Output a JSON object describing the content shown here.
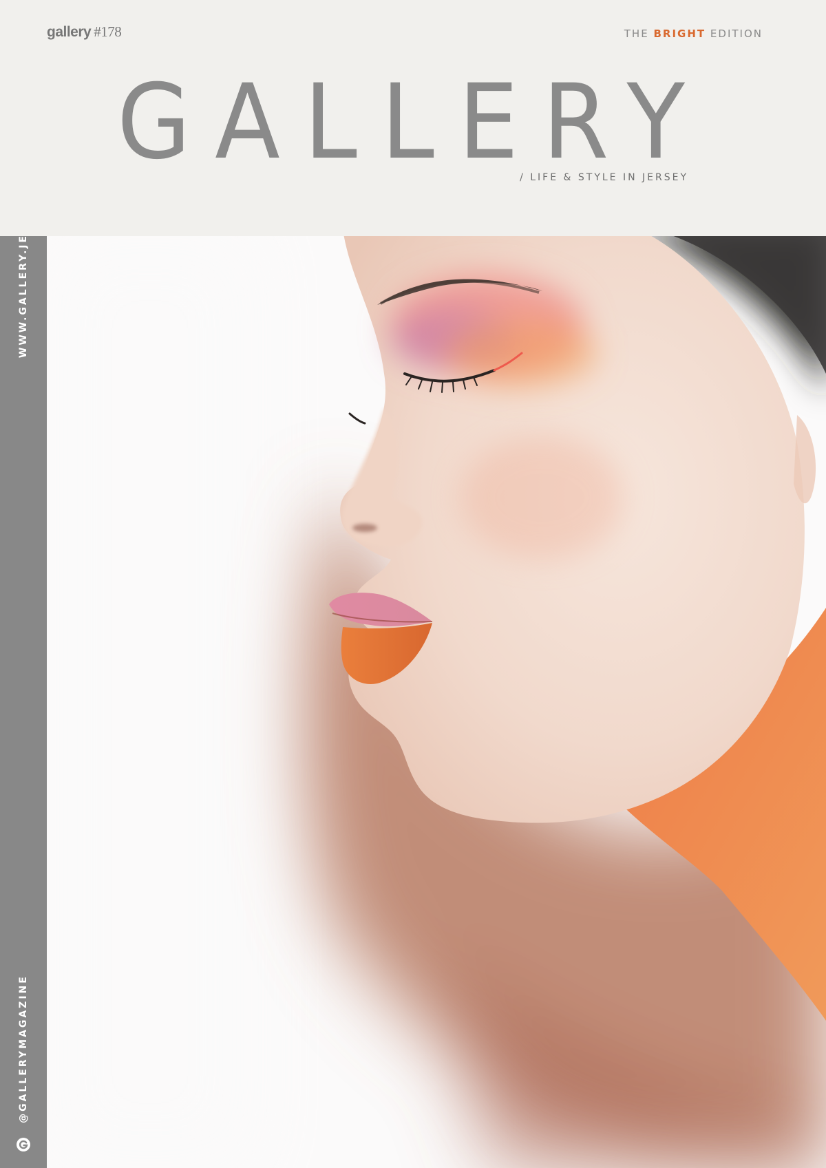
{
  "header": {
    "issue_brand": "gallery",
    "issue_number": "#178",
    "edition_prefix": "THE",
    "edition_accent": "BRIGHT",
    "edition_suffix": "EDITION",
    "masthead": "GALLERY",
    "tagline": "/ LIFE & STYLE IN JERSEY"
  },
  "spine": {
    "website": "WWW.GALLERY.JE",
    "social": "@GALLERYMAGAZINE",
    "logo_letter": "G",
    "logo_icon": "gallery-g-logo-icon"
  },
  "cover_photo": {
    "subject": "profile portrait of a woman with orange and pink makeup"
  },
  "colors": {
    "background": "#f1f0ed",
    "masthead_gray": "#8a8a8a",
    "spine_gray": "#888888",
    "accent_orange": "#d9692f"
  }
}
